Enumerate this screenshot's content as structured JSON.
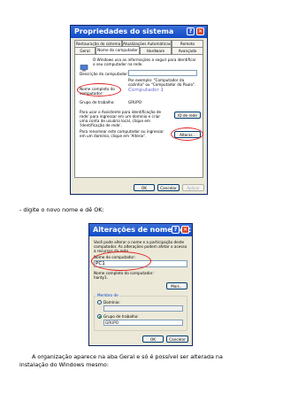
{
  "window1": {
    "title": "Propriedades do sistema",
    "tabs_row1": [
      "Restauração do sistema",
      "Atualizações Automáticas",
      "Remoto"
    ],
    "tabs_row2": [
      "Geral",
      "Nome do computador",
      "Hardware",
      "Avançado"
    ],
    "intro_text": "O Windows usa as informações a seguir para identificar o seu computador na rede.",
    "description_label": "Descrição do computador:",
    "description_value": "",
    "example_text": "Por exemplo: \"Computador da cozinha\" ou \"Computador do Paulo\".",
    "fullname_label": "Nome completo do computador:",
    "fullname_value": "Computador 1",
    "workgroup_label": "Grupo de trabalho:",
    "workgroup_value": "GRUPO",
    "wizard_text": "Para usar o Assistente para identificação de rede' para ingressar em um domínio e criar uma conta de usuário local, clique em 'Identificação de rede'.",
    "network_id_button": "ID de rede",
    "rename_text": "Para renomear este computador ou ingressar em um domínio, clique em 'Alterar'.",
    "change_button": "Alterar...",
    "ok_button": "OK",
    "cancel_button": "Cancelar",
    "apply_button": "Aplicar"
  },
  "caption1": "- digite o novo nome e dê OK:",
  "window2": {
    "title": "Alterações de nome do c...",
    "intro_text": "Você pode alterar o nome e a participação deste computador. As alterações podem afetar o acesso a recursos da rede.",
    "name_label": "Nome do computador:",
    "name_value": "PC1",
    "fullname_label": "Nome completo do computador:",
    "fullname_value": "hardy1.",
    "more_button": "Mais...",
    "member_group_label": "Membro de",
    "domain_label": "Domínio:",
    "domain_value": "",
    "workgroup_label": "Grupo de trabalho:",
    "workgroup_value": "GRUPO",
    "ok_button": "OK",
    "cancel_button": "Cancelar"
  },
  "caption2": "A organização aparece na aba Geral e só é possível ser alterada na instalação do Windows mesmo:",
  "colors": {
    "titlebar": "#0f4ac7",
    "highlight_oval": "#e02020",
    "dialog_bg": "#ece9d8"
  },
  "icons": [
    "help-icon",
    "close-icon",
    "computer-icon"
  ]
}
